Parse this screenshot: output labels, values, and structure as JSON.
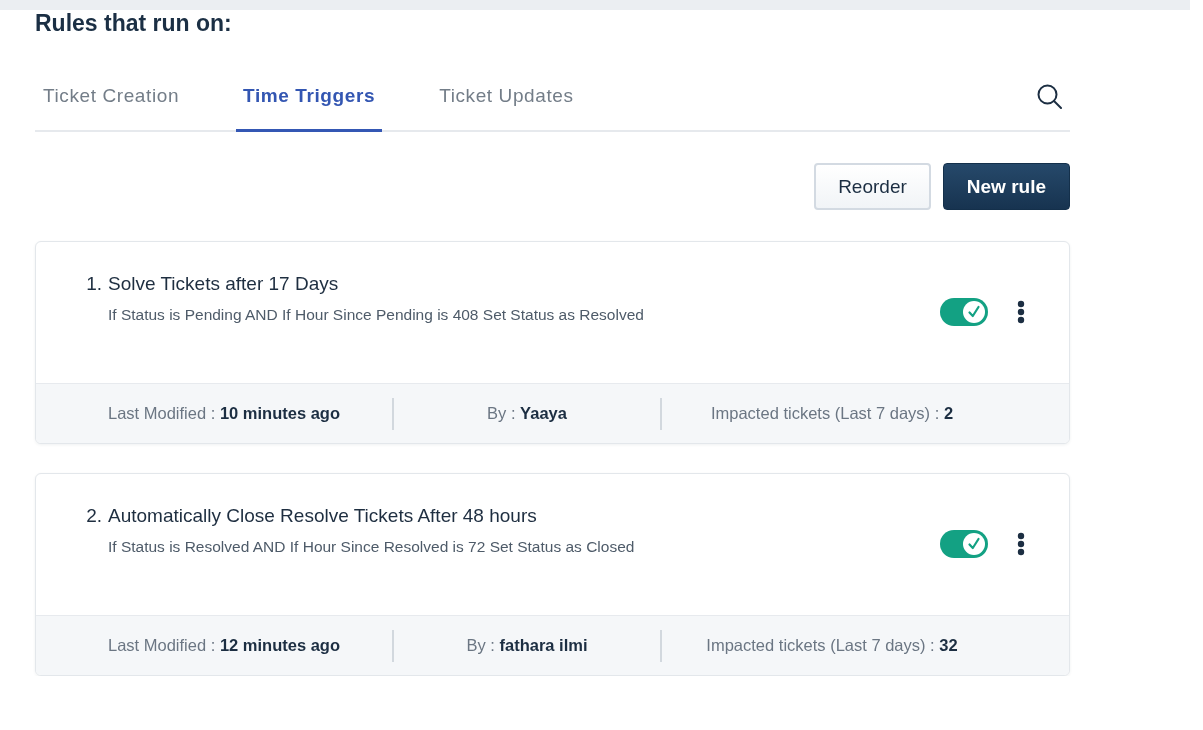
{
  "title": "Rules that run on:",
  "tabs": [
    {
      "label": "Ticket Creation",
      "selected": false
    },
    {
      "label": "Time Triggers",
      "selected": true
    },
    {
      "label": "Ticket Updates",
      "selected": false
    }
  ],
  "toolbar": {
    "buttons": [
      {
        "label": "Reorder",
        "kind": "secondary"
      },
      {
        "label": "New rule",
        "kind": "primary"
      }
    ]
  },
  "rules": [
    {
      "number": "1.",
      "title": "Solve Tickets after 17 Days",
      "description": "If Status is Pending AND If Hour Since Pending is 408 Set Status as Resolved",
      "enabled": true,
      "footer": [
        {
          "label": "Last Modified :",
          "value": "10 minutes ago"
        },
        {
          "label": "By :",
          "value": "Yaaya"
        },
        {
          "label": "Impacted tickets (Last 7 days) :",
          "value": "2"
        }
      ]
    },
    {
      "number": "2.",
      "title": "Automatically Close Resolve Tickets After 48 hours",
      "description": "If Status is Resolved AND If Hour Since Resolved is 72 Set Status as Closed",
      "enabled": true,
      "footer": [
        {
          "label": "Last Modified :",
          "value": "12 minutes ago"
        },
        {
          "label": "By :",
          "value": "fathara ilmi"
        },
        {
          "label": "Impacted tickets (Last 7 days) :",
          "value": "32"
        }
      ]
    }
  ]
}
